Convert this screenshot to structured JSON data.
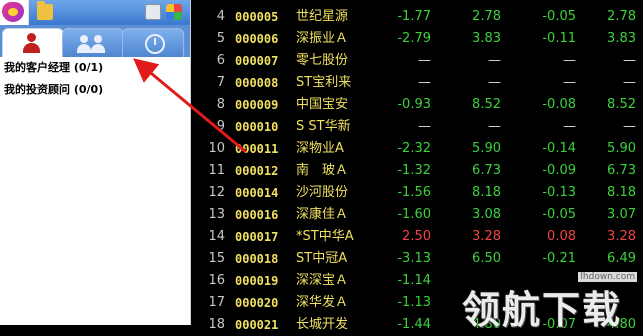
{
  "sidebar": {
    "items": [
      {
        "label": "我的客户经理 (0/1)"
      },
      {
        "label": "我的投资顾问 (0/0)"
      }
    ]
  },
  "watermark": {
    "url": "lhdown.com",
    "text": "领航下载"
  },
  "stocks": [
    {
      "idx": "4",
      "code": "000005",
      "name": "世纪星源",
      "v1": "-1.77",
      "v2": "2.78",
      "v3": "-0.05",
      "v4": "2.78",
      "c1": "green",
      "c2": "green",
      "c3": "green",
      "c4": "green"
    },
    {
      "idx": "5",
      "code": "000006",
      "name": "深振业Ａ",
      "v1": "-2.79",
      "v2": "3.83",
      "v3": "-0.11",
      "v4": "3.83",
      "c1": "green",
      "c2": "green",
      "c3": "green",
      "c4": "green"
    },
    {
      "idx": "6",
      "code": "000007",
      "name": "零七股份",
      "v1": "—",
      "v2": "—",
      "v3": "—",
      "v4": "—",
      "c1": "white",
      "c2": "white",
      "c3": "white",
      "c4": "white"
    },
    {
      "idx": "7",
      "code": "000008",
      "name": "ST宝利来",
      "v1": "—",
      "v2": "—",
      "v3": "—",
      "v4": "—",
      "c1": "white",
      "c2": "white",
      "c3": "white",
      "c4": "white"
    },
    {
      "idx": "8",
      "code": "000009",
      "name": "中国宝安",
      "v1": "-0.93",
      "v2": "8.52",
      "v3": "-0.08",
      "v4": "8.52",
      "c1": "green",
      "c2": "green",
      "c3": "green",
      "c4": "green"
    },
    {
      "idx": "9",
      "code": "000010",
      "name": "S ST华新",
      "v1": "—",
      "v2": "—",
      "v3": "—",
      "v4": "—",
      "c1": "white",
      "c2": "white",
      "c3": "white",
      "c4": "white"
    },
    {
      "idx": "10",
      "code": "000011",
      "name": "深物业A",
      "v1": "-2.32",
      "v2": "5.90",
      "v3": "-0.14",
      "v4": "5.90",
      "c1": "green",
      "c2": "green",
      "c3": "green",
      "c4": "green"
    },
    {
      "idx": "11",
      "code": "000012",
      "name": "南　玻Ａ",
      "v1": "-1.32",
      "v2": "6.73",
      "v3": "-0.09",
      "v4": "6.73",
      "c1": "green",
      "c2": "green",
      "c3": "green",
      "c4": "green"
    },
    {
      "idx": "12",
      "code": "000014",
      "name": "沙河股份",
      "v1": "-1.56",
      "v2": "8.18",
      "v3": "-0.13",
      "v4": "8.18",
      "c1": "green",
      "c2": "green",
      "c3": "green",
      "c4": "green"
    },
    {
      "idx": "13",
      "code": "000016",
      "name": "深康佳Ａ",
      "v1": "-1.60",
      "v2": "3.08",
      "v3": "-0.05",
      "v4": "3.07",
      "c1": "green",
      "c2": "green",
      "c3": "green",
      "c4": "green"
    },
    {
      "idx": "14",
      "code": "000017",
      "name": "*ST中华A",
      "v1": "2.50",
      "v2": "3.28",
      "v3": "0.08",
      "v4": "3.28",
      "c1": "red",
      "c2": "red",
      "c3": "red",
      "c4": "red"
    },
    {
      "idx": "15",
      "code": "000018",
      "name": "ST中冠A",
      "v1": "-3.13",
      "v2": "6.50",
      "v3": "-0.21",
      "v4": "6.49",
      "c1": "green",
      "c2": "green",
      "c3": "green",
      "c4": "green"
    },
    {
      "idx": "16",
      "code": "000019",
      "name": "深深宝Ａ",
      "v1": "-1.14",
      "v2": "",
      "v3": "",
      "v4": "",
      "c1": "green",
      "c2": "green",
      "c3": "green",
      "c4": "green"
    },
    {
      "idx": "17",
      "code": "000020",
      "name": "深华发Ａ",
      "v1": "-1.13",
      "v2": "",
      "v3": "",
      "v4": "",
      "c1": "green",
      "c2": "green",
      "c3": "green",
      "c4": "green"
    },
    {
      "idx": "18",
      "code": "000021",
      "name": "长城开发",
      "v1": "-1.44",
      "v2": "4.80",
      "v3": "-0.07",
      "v4": "4.80",
      "c1": "green",
      "c2": "green",
      "c3": "green",
      "c4": "green"
    }
  ]
}
